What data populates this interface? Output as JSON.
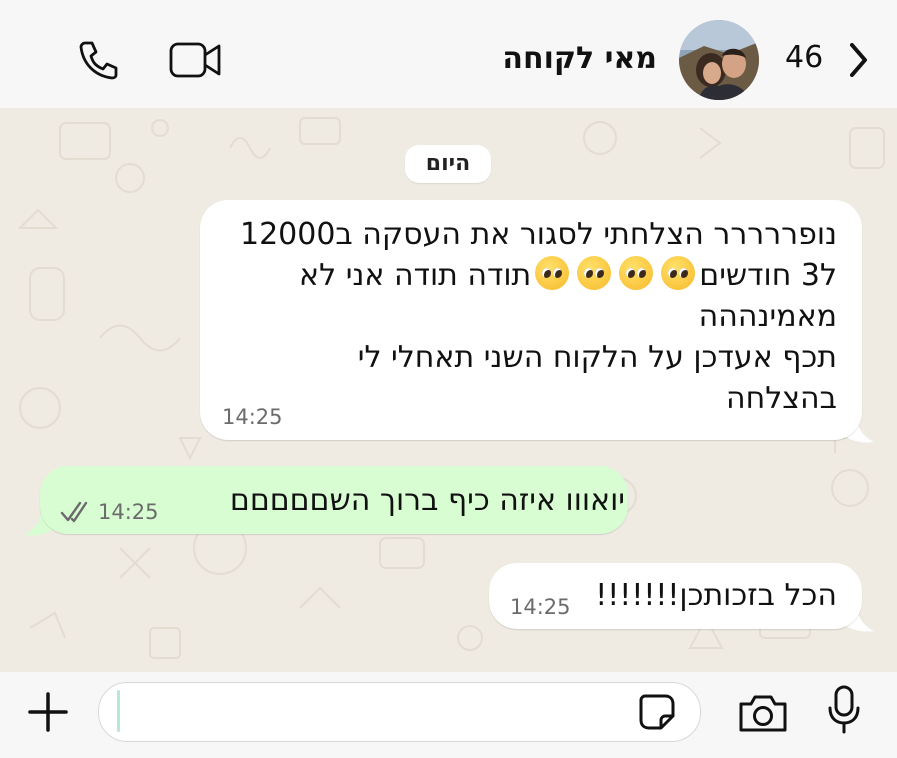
{
  "header": {
    "back_count": "46",
    "contact_name": "מאי לקוחה",
    "icons": [
      "phone-icon",
      "video-icon",
      "chevron-left-icon",
      "avatar"
    ]
  },
  "chat": {
    "date_divider": "היום",
    "messages": [
      {
        "direction": "incoming",
        "lines": [
          "נופררררר הצלחתי לסגור את העסקה ב12000",
          "ל3 חודשים",
          "תודה תודה אני לא",
          "מאמינההה",
          "תכף אעדכן על הלקוח השני תאחלי לי",
          "בהצלחה"
        ],
        "emoji_count": 4,
        "time": "14:25"
      },
      {
        "direction": "outgoing",
        "text": "יואווו איזה כיף ברוך השםםםםם",
        "time": "14:25",
        "status": "read"
      },
      {
        "direction": "incoming",
        "text": "הכל בזכותכן!!!!!!!",
        "time": "14:25"
      }
    ]
  },
  "composer": {
    "input_value": "",
    "icons": [
      "plus-icon",
      "sticker-icon",
      "camera-icon",
      "microphone-icon"
    ]
  },
  "colors": {
    "chat_background": "#efeae2",
    "incoming_bubble": "#ffffff",
    "outgoing_bubble": "#d9fdd3",
    "bars": "#f7f7f7",
    "read_ticks": "#6b6b6b"
  }
}
